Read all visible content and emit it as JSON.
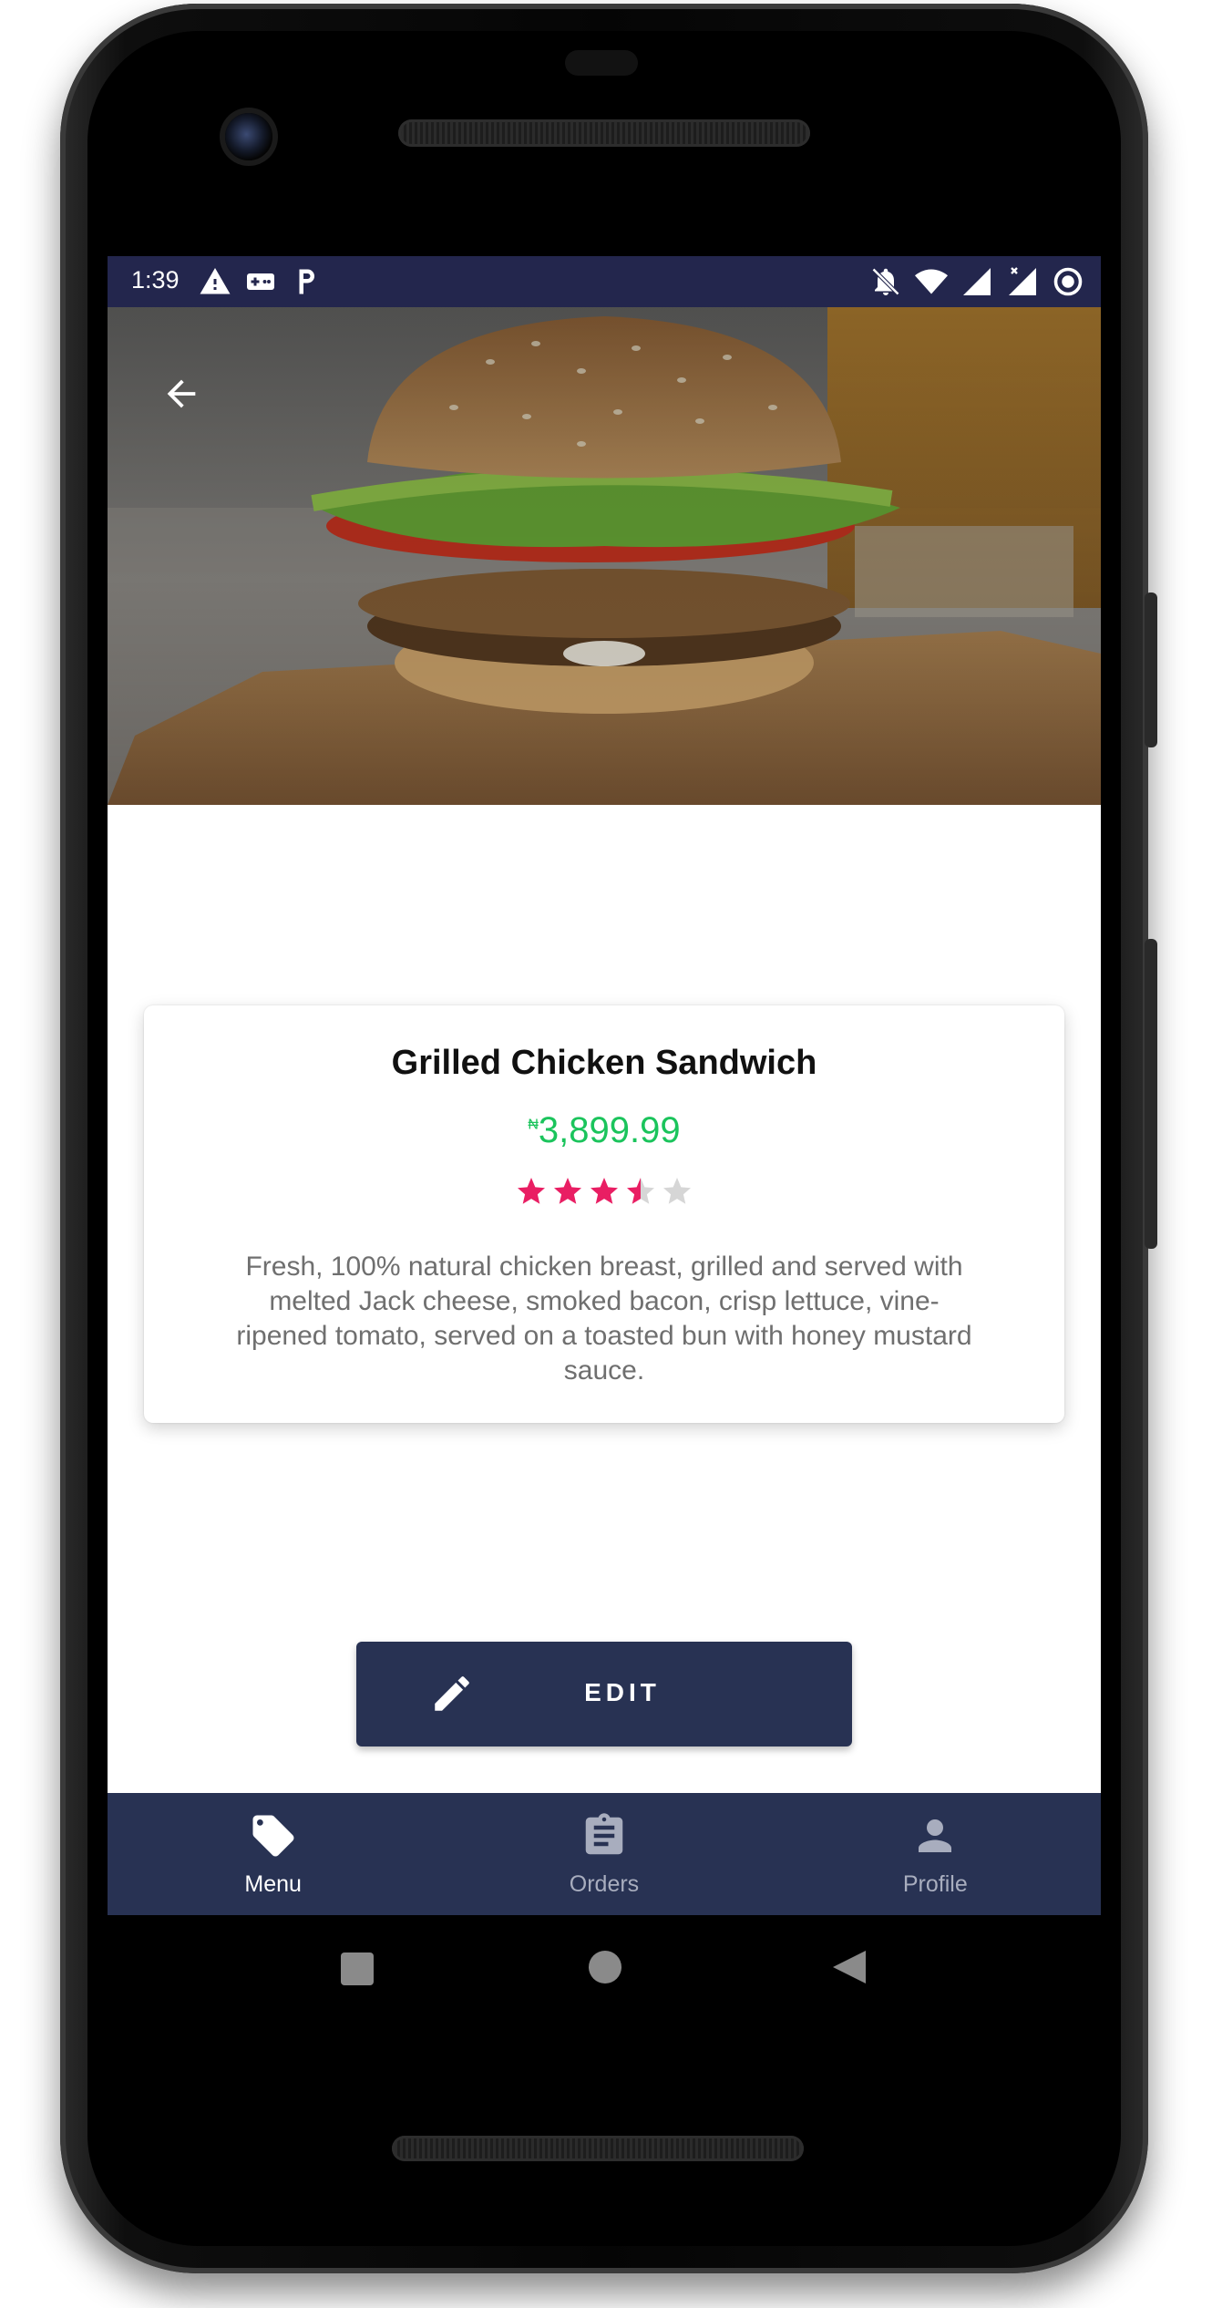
{
  "status_bar": {
    "time": "1:39",
    "left_icons": [
      "warning-icon",
      "gamepad-icon",
      "parking-icon"
    ],
    "right_icons": [
      "notifications-off-icon",
      "wifi-icon",
      "signal-icon",
      "signal-x-icon",
      "record-icon"
    ]
  },
  "header": {
    "back_icon": "arrow-left-icon"
  },
  "product": {
    "name": "Grilled Chicken Sandwich",
    "currency_symbol": "₦",
    "price": "3,899.99",
    "rating": 3.5,
    "rating_max": 5,
    "description": "Fresh, 100% natural chicken breast, grilled and served with melted Jack cheese, smoked bacon, crisp lettuce, vine-ripened tomato, served on a toasted bun with honey mustard sauce."
  },
  "edit_button": {
    "label": "EDIT",
    "icon": "pencil-icon"
  },
  "bottom_nav": {
    "items": [
      {
        "label": "Menu",
        "icon": "tag-icon",
        "active": true
      },
      {
        "label": "Orders",
        "icon": "clipboard-icon",
        "active": false
      },
      {
        "label": "Profile",
        "icon": "person-icon",
        "active": false
      }
    ]
  },
  "colors": {
    "status_bar": "#23264d",
    "primary": "#283253",
    "price": "#1bc45c",
    "star_active": "#e91e63",
    "star_inactive": "#d6d6d6"
  }
}
